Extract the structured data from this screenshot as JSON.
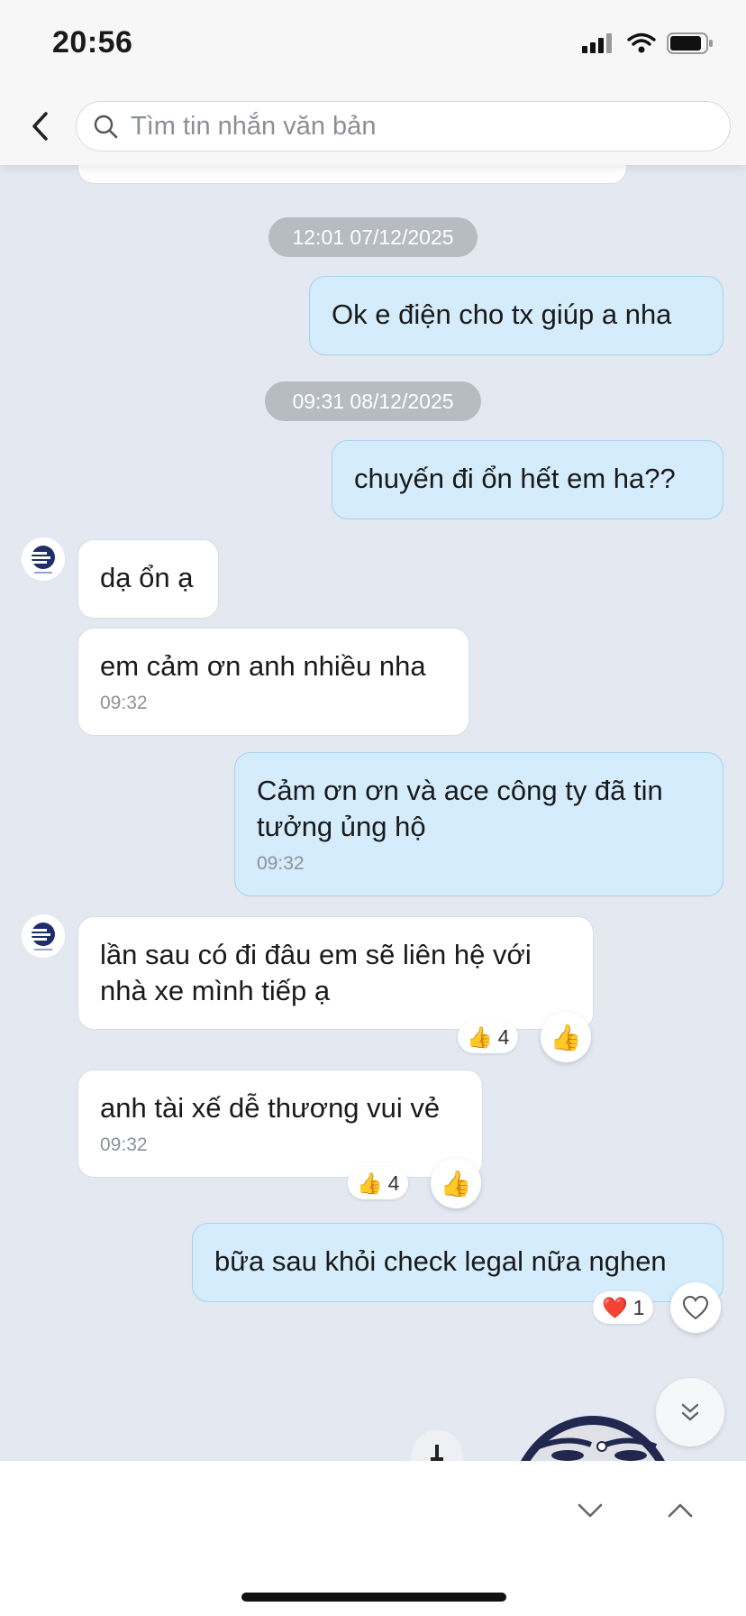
{
  "status": {
    "time": "20:56"
  },
  "search": {
    "placeholder": "Tìm tin nhắn văn bản"
  },
  "messages": {
    "stamp1": "12:01 07/12/2025",
    "m1": "Ok e điện cho tx giúp a nha",
    "stamp2": "09:31 08/12/2025",
    "m2": "chuyến đi ổn hết em ha??",
    "m3": "dạ ổn ạ",
    "m4": "em cảm ơn anh nhiều nha",
    "m4_time": "09:32",
    "m5_line1": "Cảm ơn ơn và ace công ty đã tin",
    "m5_line2": "tưởng ủng hộ",
    "m5_time": "09:32",
    "m6_line1": "lần sau có đi đâu em sẽ liên hệ với",
    "m6_line2": "nhà xe mình tiếp ạ",
    "m6_reaction_count": "4",
    "m7": "anh tài xế dễ thương vui vẻ",
    "m7_time": "09:32",
    "m7_reaction_count": "4",
    "m8": "bữa sau khỏi check legal nữa nghen",
    "m8_reaction_count": "1"
  },
  "icons": {
    "thumbs_up": "👍",
    "heart": "❤️"
  },
  "colors": {
    "background": "#e3e8f1",
    "outgoing_bubble": "#d4ecfb",
    "incoming_bubble": "#ffffff",
    "stamp": "#b7bbc2"
  }
}
